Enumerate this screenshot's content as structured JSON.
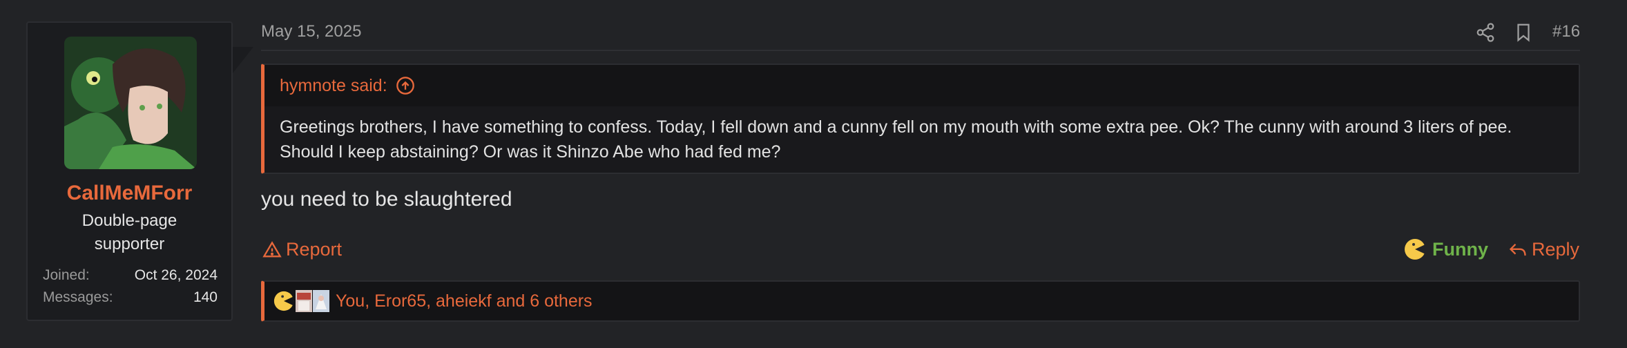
{
  "user": {
    "name": "CallMeMForr",
    "title_line1": "Double-page",
    "title_line2": "supporter",
    "joined_label": "Joined:",
    "joined_value": "Oct 26, 2024",
    "messages_label": "Messages:",
    "messages_value": "140"
  },
  "post": {
    "date": "May 15, 2025",
    "number": "#16",
    "share_icon": "share-icon",
    "bookmark_icon": "bookmark-icon",
    "text": "you need to be slaughtered"
  },
  "quote": {
    "author": "hymnote said:",
    "text": "Greetings brothers, I have something to confess. Today, I fell down and a cunny fell on my mouth with some extra pee. Ok? The cunny with around 3 liters of pee. Should I keep abstaining? Or was it Shinzo Abe who had fed me?"
  },
  "actions": {
    "report": "Report",
    "react": "Funny",
    "reply": "Reply"
  },
  "reactions": {
    "text": "You, Eror65, aheiekf and 6 others"
  },
  "colors": {
    "accent": "#e8693c",
    "funny": "#6fb34a",
    "background": "#222326"
  }
}
